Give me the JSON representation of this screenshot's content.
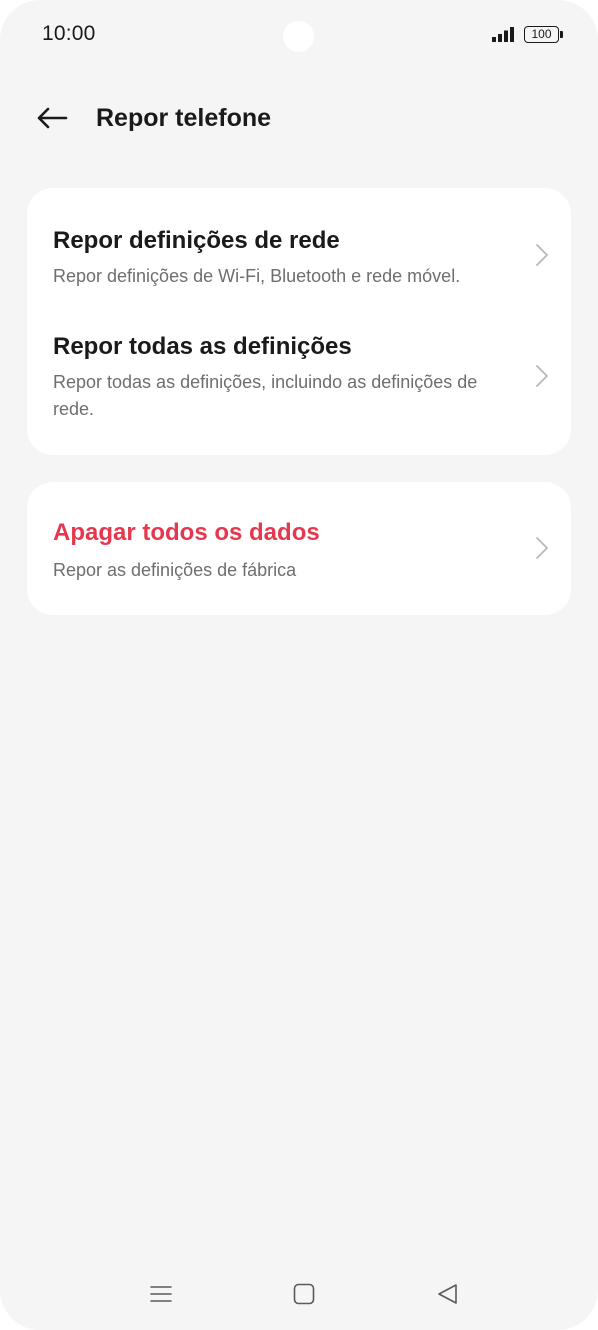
{
  "status_bar": {
    "time": "10:00",
    "battery": "100",
    "icons": [
      "signal-icon",
      "battery-icon"
    ]
  },
  "header": {
    "back_icon": "arrow-left-icon",
    "title": "Repor telefone"
  },
  "sections": [
    {
      "items": [
        {
          "title": "Repor definições de rede",
          "subtitle": "Repor definições de Wi-Fi, Bluetooth e rede móvel."
        },
        {
          "title": "Repor todas as definições",
          "subtitle": "Repor todas as definições, incluindo as definições de rede."
        }
      ]
    },
    {
      "items": [
        {
          "title": "Apagar todos os dados",
          "subtitle": "Repor as definições de fábrica",
          "color": "#e5384f"
        }
      ]
    }
  ],
  "nav_bar": {
    "icons": [
      "menu-icon",
      "home-icon",
      "back-triangle-icon"
    ]
  },
  "colors": {
    "background": "#f5f5f5",
    "card": "#ffffff",
    "danger": "#e5384f",
    "text_primary": "#1a1a1a",
    "text_secondary": "#6e6e6e"
  }
}
